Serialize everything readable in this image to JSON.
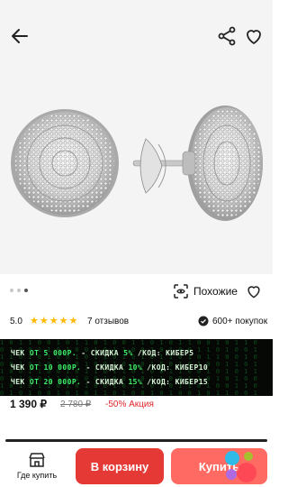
{
  "header": {
    "back_icon": "arrow-left-icon",
    "share_icon": "share-icon",
    "favorite_icon": "heart-icon"
  },
  "gallery": {
    "dots_count": 3,
    "active_dot": 2,
    "similar_label": "Похожие",
    "similar_icon": "similar-icon",
    "favorite_icon": "heart-icon"
  },
  "rating": {
    "value": "5.0",
    "stars": 5,
    "reviews": "7 отзывов",
    "buyers": "600+ покупок"
  },
  "promo": {
    "lines": [
      {
        "a": "ЧЕК ",
        "b": "ОТ 5 000Р.",
        "c": " - СКИДКА ",
        "d": "5%",
        "e": "  /КОД: ",
        "f": "КИБЕР5"
      },
      {
        "a": "ЧЕК ",
        "b": "ОТ 10 000Р.",
        "c": " - СКИДКА ",
        "d": "10%",
        "e": " /КОД: ",
        "f": "КИБЕР10"
      },
      {
        "a": "ЧЕК ",
        "b": "ОТ 20 000Р.",
        "c": " - СКИДКА ",
        "d": "15%",
        "e": " /КОД: ",
        "f": "КИБЕР15"
      }
    ]
  },
  "price": {
    "current": "1 390 ₽",
    "old": "2 780 ₽",
    "discount": "-50% Акция"
  },
  "bottom": {
    "quick_buy_label": "Где купить",
    "cart_label": "В корзину",
    "buy_label": "Купить",
    "colors": {
      "cart": "#e53935",
      "buy": "#ff6b63"
    }
  }
}
